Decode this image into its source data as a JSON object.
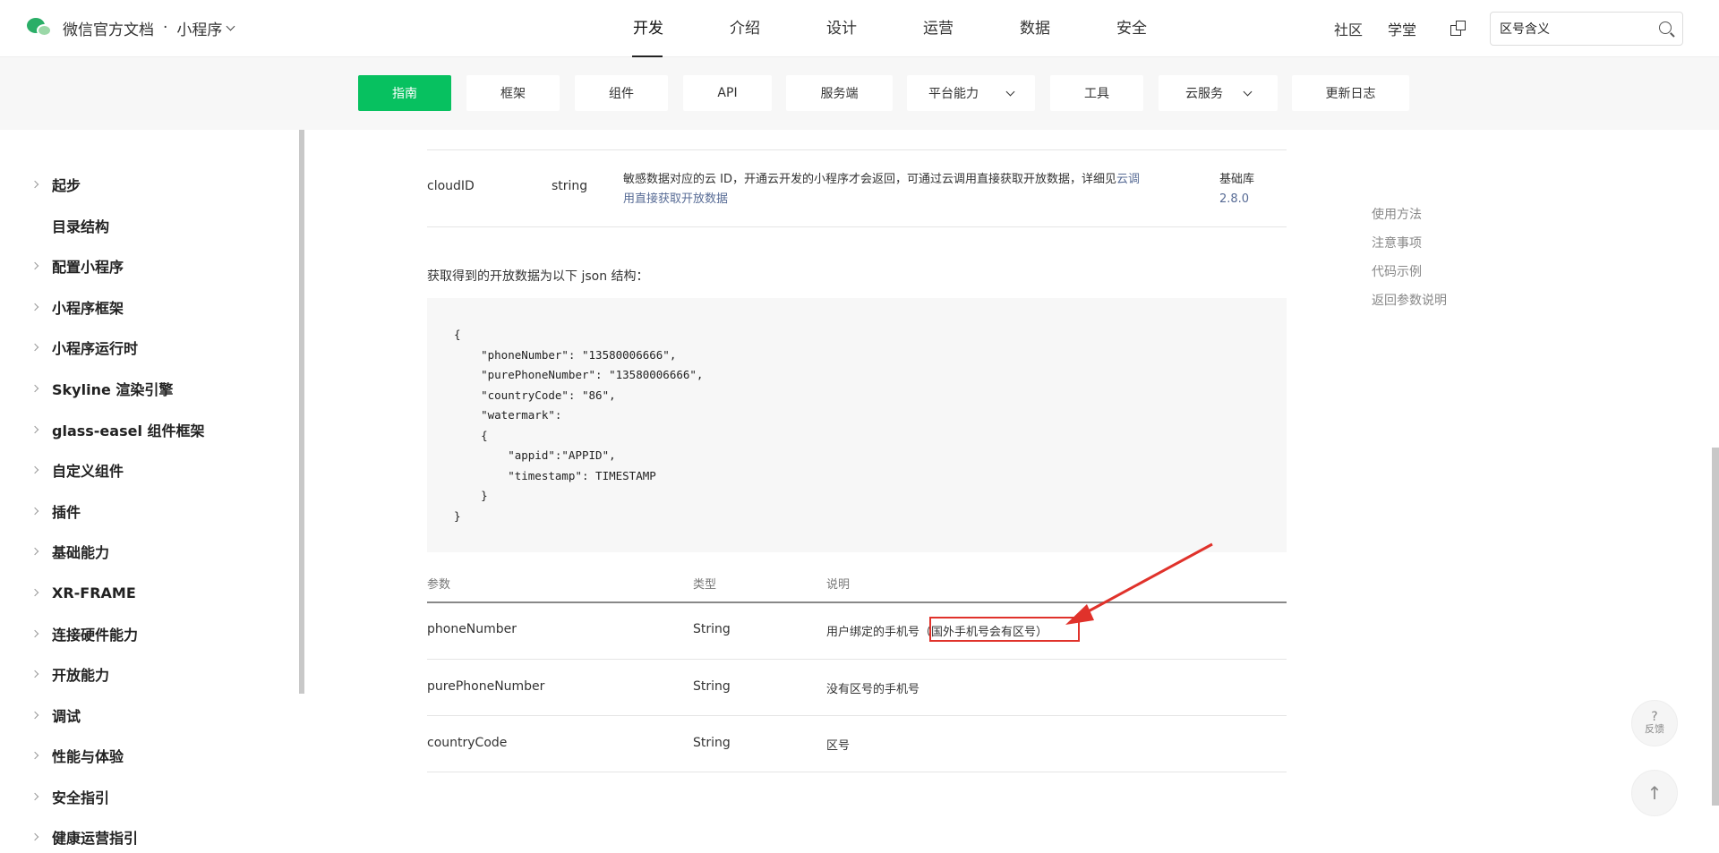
{
  "header": {
    "brand_title": "微信官方文档",
    "brand_sep": "·",
    "brand_section": "小程序",
    "nav": [
      "开发",
      "介绍",
      "设计",
      "运营",
      "数据",
      "安全"
    ],
    "active_nav": "开发",
    "right_links": [
      "社区",
      "学堂"
    ],
    "search_value": "区号含义"
  },
  "subnav": {
    "tabs": [
      {
        "label": "指南"
      },
      {
        "label": "框架"
      },
      {
        "label": "组件"
      },
      {
        "label": "API"
      },
      {
        "label": "服务端"
      },
      {
        "label": "平台能力"
      },
      {
        "label": "工具"
      },
      {
        "label": "云服务"
      },
      {
        "label": "更新日志"
      }
    ],
    "active": "指南"
  },
  "sidebar": {
    "items": [
      {
        "label": "起步"
      },
      {
        "label": "目录结构"
      },
      {
        "label": "配置小程序"
      },
      {
        "label": "小程序框架"
      },
      {
        "label": "小程序运行时"
      },
      {
        "label": "Skyline 渲染引擎"
      },
      {
        "label": "glass-easel 组件框架"
      },
      {
        "label": "自定义组件"
      },
      {
        "label": "插件"
      },
      {
        "label": "基础能力"
      },
      {
        "label": "XR-FRAME"
      },
      {
        "label": "连接硬件能力"
      },
      {
        "label": "开放能力"
      },
      {
        "label": "调试"
      },
      {
        "label": "性能与体验"
      },
      {
        "label": "安全指引"
      },
      {
        "label": "健康运营指引"
      }
    ]
  },
  "content": {
    "cloud_row": {
      "name": "cloudID",
      "type": "string",
      "desc_prefix": "敏感数据对应的云 ID，开通云开发的小程序才会返回，可通过云调用直接获取开放数据，详细见",
      "desc_link_a": "云调",
      "desc_link_b": "用直接获取开放数据",
      "version_label": "基础库",
      "version_value": "2.8.0"
    },
    "intro_text": "获取得到的开放数据为以下 json 结构：",
    "json_code": "{\n    \"phoneNumber\": \"13580006666\",\n    \"purePhoneNumber\": \"13580006666\",\n    \"countryCode\": \"86\",\n    \"watermark\":\n    {\n        \"appid\":\"APPID\",\n        \"timestamp\": TIMESTAMP\n    }\n}",
    "table_headers": [
      "参数",
      "类型",
      "说明"
    ],
    "table_rows": [
      {
        "param": "phoneNumber",
        "type": "String",
        "desc": "用户绑定的手机号",
        "note": "（国外手机号会有区号）"
      },
      {
        "param": "purePhoneNumber",
        "type": "String",
        "desc": "没有区号的手机号",
        "note": ""
      },
      {
        "param": "countryCode",
        "type": "String",
        "desc": "区号",
        "note": ""
      }
    ]
  },
  "toc": {
    "items": [
      "使用方法",
      "注意事项",
      "代码示例",
      "返回参数说明"
    ]
  },
  "floating": {
    "feedback_q": "?",
    "feedback_label": "反馈",
    "top_icon": "arrow-up-icon"
  },
  "colors": {
    "accent_green": "#07c160",
    "link_blue": "#576b95",
    "annotation_red": "#e0322b"
  }
}
